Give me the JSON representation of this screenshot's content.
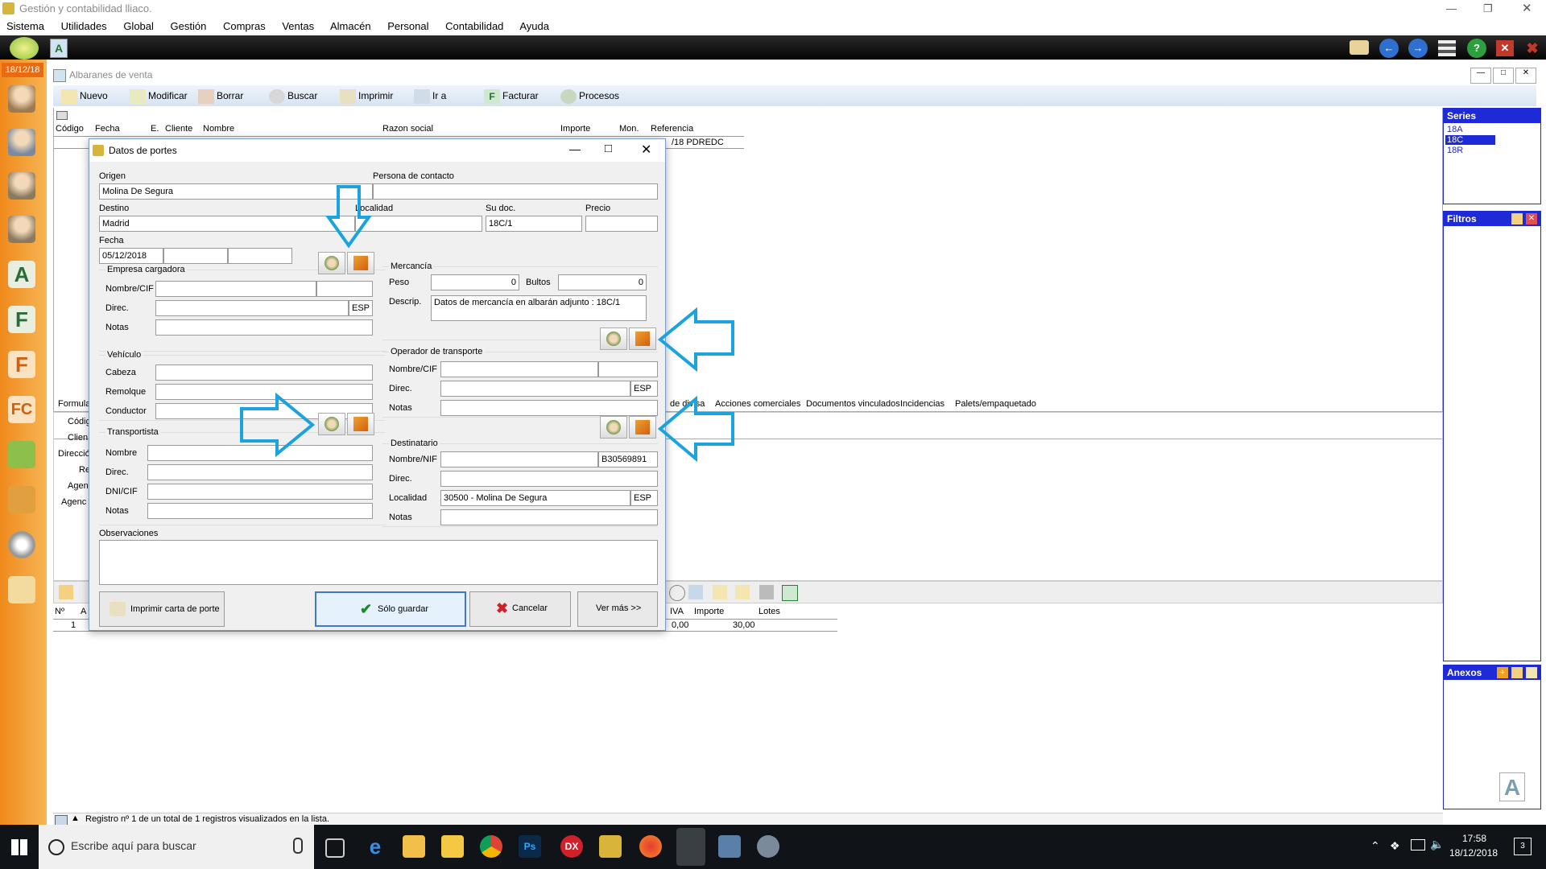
{
  "app": {
    "title": "Gestión y contabilidad lliaco.",
    "menu": [
      "Sistema",
      "Utilidades",
      "Global",
      "Gestión",
      "Compras",
      "Ventas",
      "Almacén",
      "Personal",
      "Contabilidad",
      "Ayuda"
    ],
    "date_badge": "18/12/18"
  },
  "albaranes": {
    "title": "Albaranes de venta",
    "toolbar": [
      "Nuevo",
      "Modificar",
      "Borrar",
      "Buscar",
      "Imprimir",
      "Ir a",
      "Facturar",
      "Procesos"
    ],
    "grid_headers": [
      "Código",
      "Fecha",
      "E.",
      "Cliente",
      "Nombre",
      "Razon social",
      "Importe",
      "Mon.",
      "Referencia"
    ],
    "row_ref": "/18 PDREDC",
    "tabs_right": [
      "de divisa",
      "Acciones comerciales",
      "Documentos vinculados",
      "Incidencias",
      "Palets/empaquetado"
    ],
    "left_labels": [
      "Formula",
      "Códig",
      "Clien",
      "Direcció",
      "Re",
      "Agen",
      "Agenc"
    ],
    "lines_headers": [
      "Nº",
      "A",
      "IVA",
      "Importe",
      "Lotes"
    ],
    "line_num": "1",
    "line_iva": "0,00",
    "line_importe": "30,00",
    "status": "Registro nº 1 de un total de 1 registros visualizados en la lista."
  },
  "series": {
    "title": "Series",
    "items": [
      "18A",
      "18C",
      "18R"
    ],
    "selected": "18C"
  },
  "filtros": {
    "title": "Filtros"
  },
  "anexos": {
    "title": "Anexos"
  },
  "dialog": {
    "title": "Datos de portes",
    "origen_label": "Origen",
    "origen_value": "Molina De Segura",
    "contacto_label": "Persona de contacto",
    "destino_label": "Destino",
    "destino_value": "Madrid",
    "localidad_label": "Localidad",
    "sudoc_label": "Su doc.",
    "sudoc_value": "18C/1",
    "precio_label": "Precio",
    "fecha_label": "Fecha",
    "fecha_value": "05/12/2018",
    "empresa_label": "Empresa cargadora",
    "nombrecif_label": "Nombre/CIF",
    "direc_label": "Direc.",
    "notas_label": "Notas",
    "esp": "ESP",
    "vehiculo_label": "Vehículo",
    "cabeza_label": "Cabeza",
    "remolque_label": "Remolque",
    "conductor_label": "Conductor",
    "transportista_label": "Transportista",
    "nombre_label": "Nombre",
    "dnicif_label": "DNI/CIF",
    "mercancia_label": "Mercancía",
    "peso_label": "Peso",
    "peso_value": "0",
    "bultos_label": "Bultos",
    "bultos_value": "0",
    "descrip_label": "Descrip.",
    "descrip_value": "Datos de mercancía en albarán adjunto : 18C/1",
    "operador_label": "Operador de transporte",
    "destinatario_label": "Destinatario",
    "nombrenif_label": "Nombre/NIF",
    "nif_value": "B30569891",
    "localidad_value": "30500 - Molina De Segura",
    "observaciones_label": "Observaciones",
    "btn_print": "Imprimir carta de porte",
    "btn_save": "Sólo guardar",
    "btn_cancel": "Cancelar",
    "btn_more": "Ver más >>"
  },
  "taskbar": {
    "search_placeholder": "Escribe aquí para buscar",
    "time": "17:58",
    "date": "18/12/2018",
    "notifications": "3"
  },
  "colors": {
    "accent": "#1e2ad6",
    "arrow": "#1aa3dc",
    "titlebar_blue": "#3d6fb0"
  }
}
